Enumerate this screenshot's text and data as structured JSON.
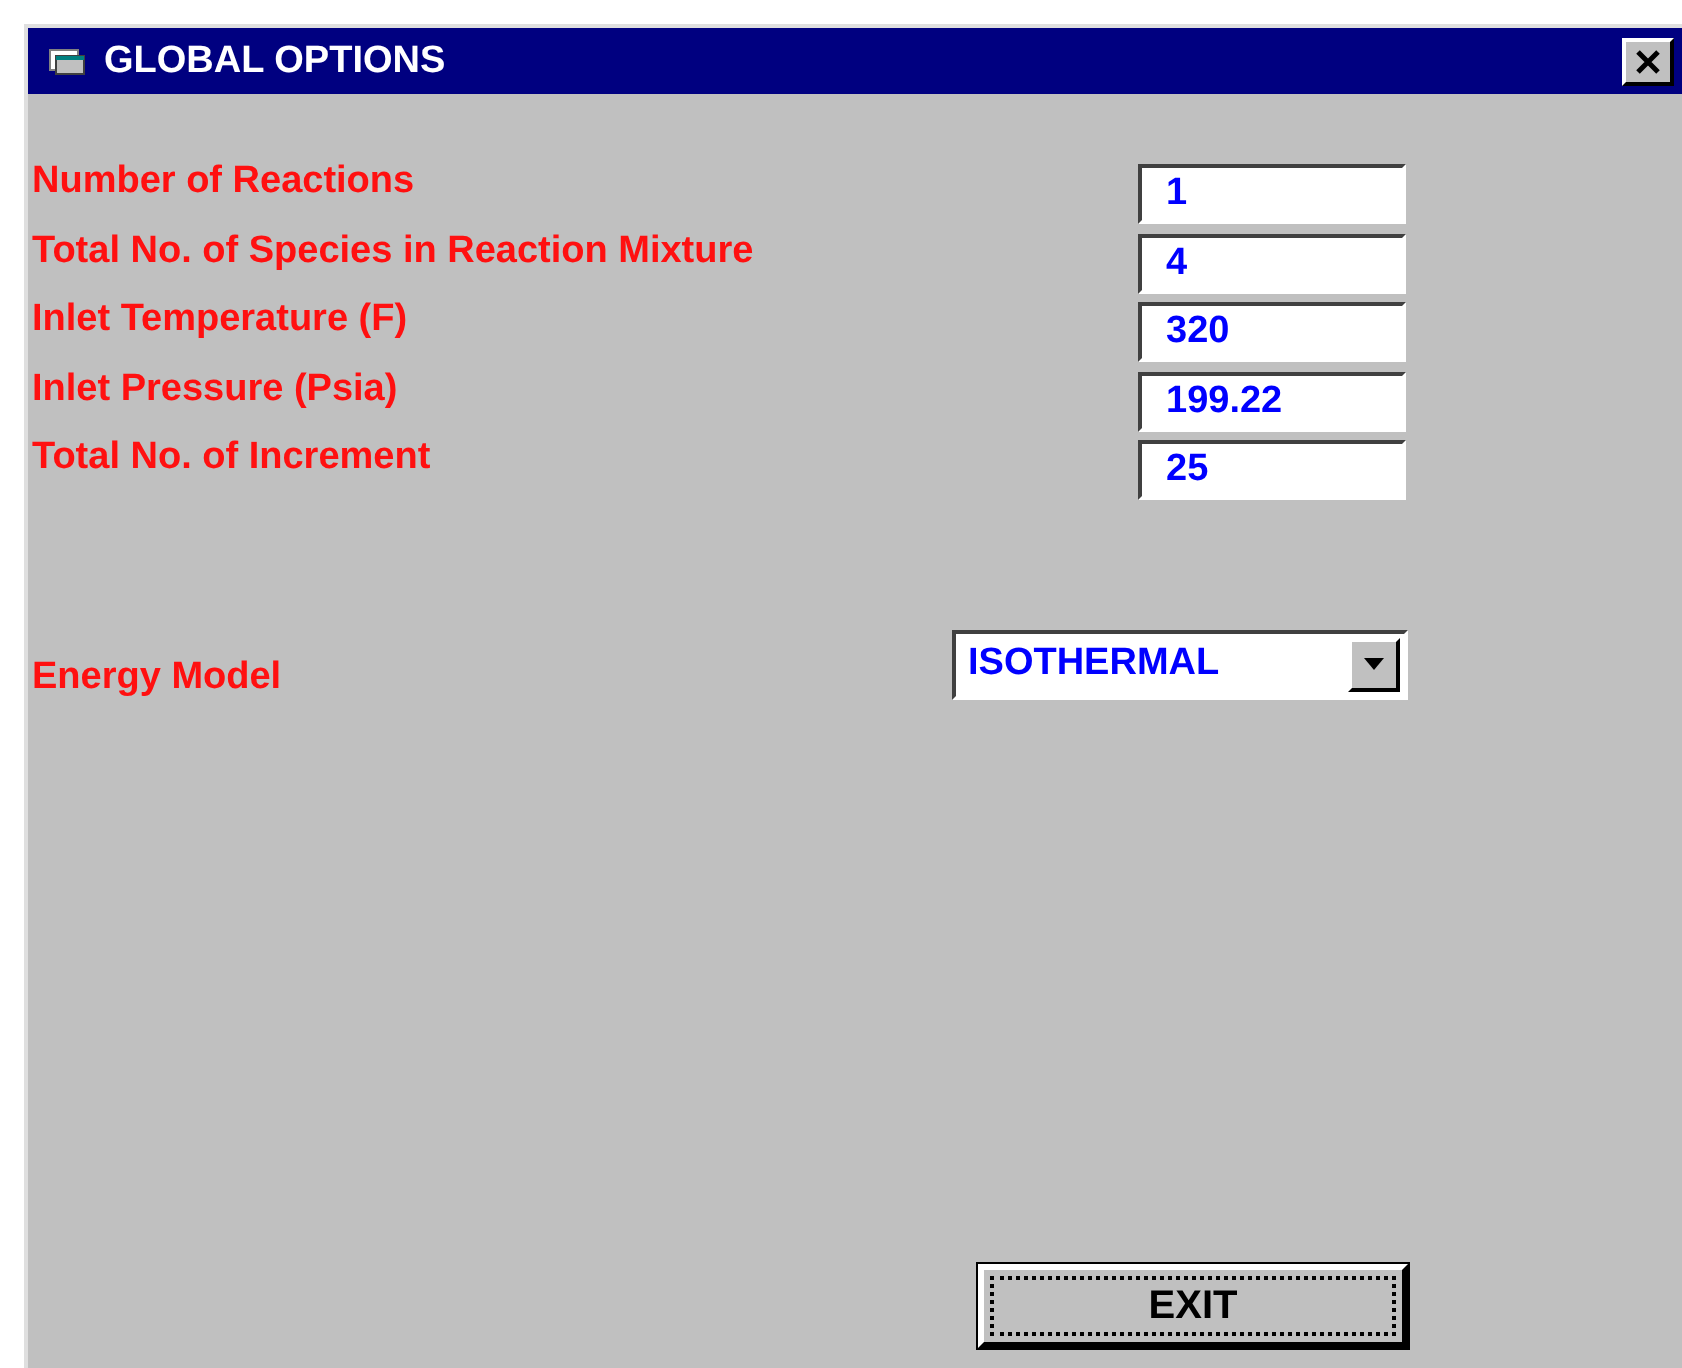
{
  "window": {
    "title": "GLOBAL OPTIONS"
  },
  "fields": [
    {
      "label": "Number of Reactions",
      "value": "1"
    },
    {
      "label": "Total No. of Species in Reaction Mixture",
      "value": "4"
    },
    {
      "label": "Inlet Temperature (F)",
      "value": "320"
    },
    {
      "label": "Inlet Pressure (Psia)",
      "value": "199.22"
    },
    {
      "label": "Total No. of Increment",
      "value": "25"
    }
  ],
  "energy_model": {
    "label": "Energy Model",
    "value": "ISOTHERMAL"
  },
  "exit_button": {
    "label": "EXIT",
    "focused": true
  }
}
